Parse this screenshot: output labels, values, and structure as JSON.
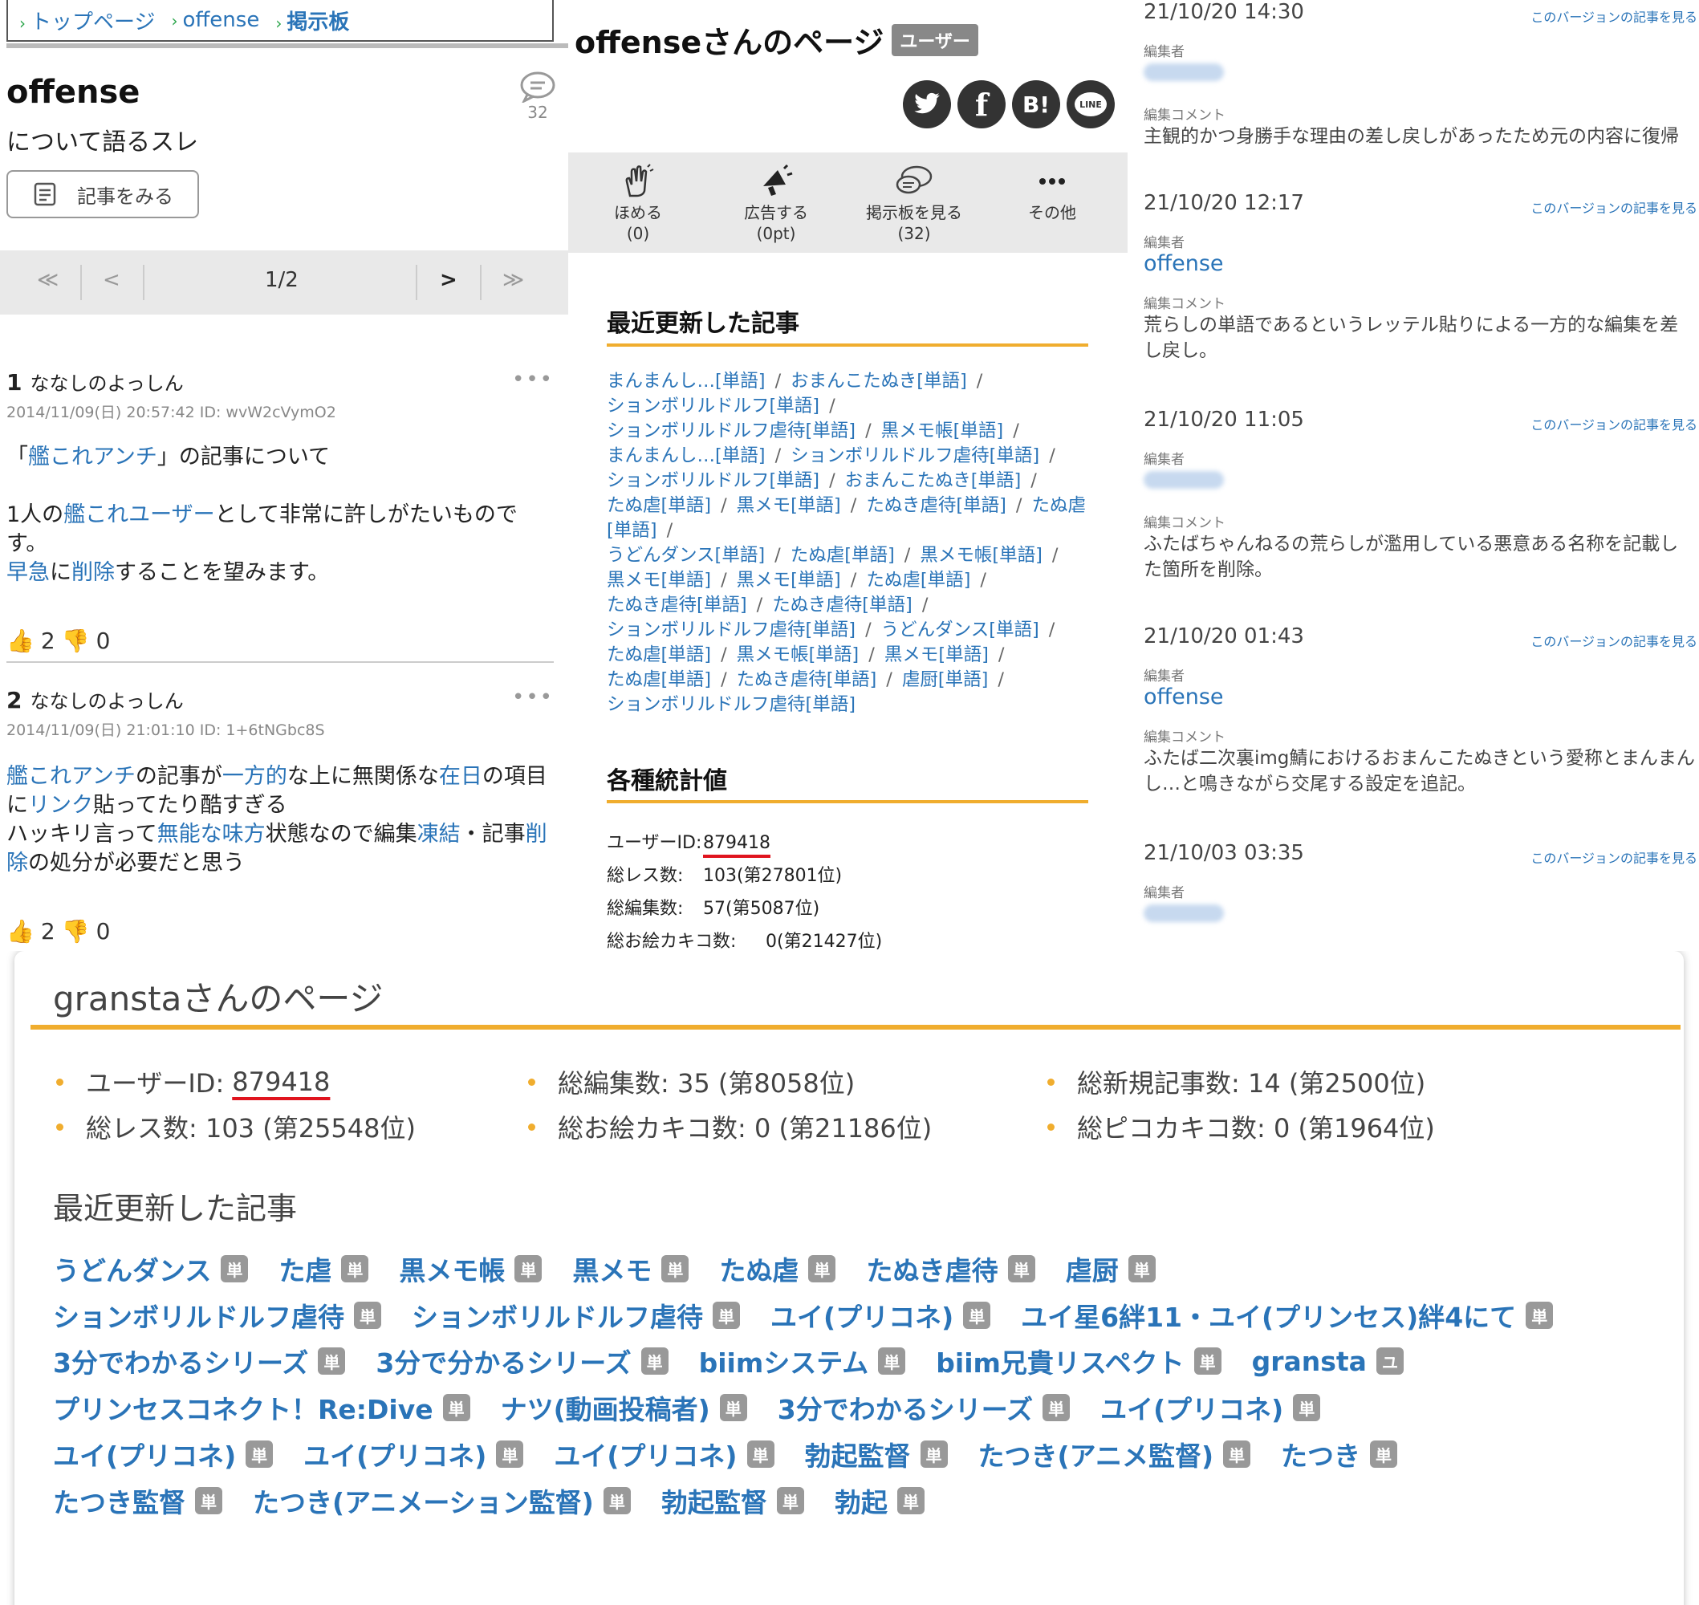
{
  "left": {
    "breadcrumb": [
      "トップページ",
      "offense",
      "掲示板"
    ],
    "title": "offense",
    "subtitle": "について語るスレ",
    "comment_count": "32",
    "view_button": "記事をみる",
    "pager": {
      "first": "≪",
      "prev": "<",
      "page": "1/2",
      "next": ">",
      "last": "≫"
    },
    "posts": [
      {
        "num": "1",
        "name": "ななしのよっしん",
        "meta": "2014/11/09(日) 20:57:42 ID: wvW2cVymO2",
        "l1a": "「",
        "l1b": "艦これアンチ",
        "l1c": "」の記事について",
        "l2a": "1人の",
        "l2b": "艦これユーザー",
        "l2c": "として非常に許しがたいもので",
        "l3": "す。",
        "l4a": "早急",
        "l4b": "に",
        "l4c": "削除",
        "l4d": "することを望みます。",
        "up": "2",
        "down": "0"
      },
      {
        "num": "2",
        "name": "ななしのよっしん",
        "meta": "2014/11/09(日) 21:01:10 ID: 1+6tNGbc8S",
        "l1a": "艦これアンチ",
        "l1b": "の記事が",
        "l1c": "一方的",
        "l1d": "な上に無関係な",
        "l1e": "在日",
        "l1f": "の項目",
        "l2a": "に",
        "l2b": "リンク",
        "l2c": "貼ってたり酷すぎる",
        "l3a": "ハッキリ言って",
        "l3b": "無能な味方",
        "l3c": "状態なので編集",
        "l3d": "凍結",
        "l3e": "・記事",
        "l3f": "削",
        "l4a": "除",
        "l4b": "の処分が必要だと思う",
        "up": "2",
        "down": "0"
      }
    ]
  },
  "mid": {
    "title": "offenseさんのページ",
    "badge": "ユーザー",
    "share": [
      "twitter-icon",
      "facebook-icon",
      "B!",
      "LINE"
    ],
    "tools": [
      {
        "label": "ほめる",
        "sub": "(0)"
      },
      {
        "label": "広告する",
        "sub": "(0pt)"
      },
      {
        "label": "掲示板を見る",
        "sub": "(32)"
      },
      {
        "label": "その他",
        "sub": ""
      }
    ],
    "recent_title": "最近更新した記事",
    "recent": [
      "まんまんし…[単語]",
      "おまんこたぬき[単語]",
      "ションボリルドルフ[単語]",
      "ションボリルドルフ虐待[単語]",
      "黒メモ帳[単語]",
      "まんまんし…[単語]",
      "ションボリルドルフ虐待[単語]",
      "ションボリルドルフ[単語]",
      "おまんこたぬき[単語]",
      "たぬ虐[単語]",
      "黒メモ[単語]",
      "たぬき虐待[単語]",
      "たぬ虐[単語]",
      "うどんダンス[単語]",
      "たぬ虐[単語]",
      "黒メモ帳[単語]",
      "黒メモ[単語]",
      "黒メモ[単語]",
      "たぬ虐[単語]",
      "たぬき虐待[単語]",
      "たぬき虐待[単語]",
      "ションボリルドルフ虐待[単語]",
      "うどんダンス[単語]",
      "たぬ虐[単語]",
      "黒メモ帳[単語]",
      "黒メモ[単語]",
      "たぬ虐[単語]",
      "たぬき虐待[単語]",
      "虐厨[単語]",
      "ションボリルドルフ虐待[単語]"
    ],
    "stats_title": "各種統計値",
    "stats": [
      {
        "label": "ユーザーID:",
        "value": "879418"
      },
      {
        "label": "総レス数:",
        "value": "103(第27801位)"
      },
      {
        "label": "総編集数:",
        "value": "57(第5087位)"
      },
      {
        "label": "総お絵カキコ数:",
        "value": "0(第21427位)"
      }
    ]
  },
  "right": {
    "link_text": "このバージョンの記事を見る",
    "editor_label": "編集者",
    "comment_label": "編集コメント",
    "revisions": [
      {
        "date": "21/10/20 14:30",
        "user": "",
        "comment": "主観的かつ身勝手な理由の差し戻しがあったため元の内容に復帰"
      },
      {
        "date": "21/10/20 12:17",
        "user": "offense",
        "comment": "荒らしの単語であるというレッテル貼りによる一方的な編集を差",
        "comment2": "し戻し。"
      },
      {
        "date": "21/10/20 11:05",
        "user": "",
        "comment": "ふたばちゃんねるの荒らしが濫用している悪意ある名称を記載し",
        "comment2": "た箇所を削除。"
      },
      {
        "date": "21/10/20 01:43",
        "user": "offense",
        "comment": "ふたば二次裏img鯖におけるおまんこたぬきという愛称とまんまん",
        "comment2": "し…と鳴きながら交尾する設定を追記。"
      },
      {
        "date": "21/10/03 03:35",
        "user": "",
        "comment": ""
      }
    ]
  },
  "bottom": {
    "title": "granstaさんのページ",
    "stats": [
      {
        "label": "ユーザーID: ",
        "value": "879418"
      },
      {
        "label": "総編集数: 35 (第8058位)",
        "value": ""
      },
      {
        "label": "総新規記事数: 14 (第2500位)",
        "value": ""
      },
      {
        "label": "総レス数: 103 (第25548位)",
        "value": ""
      },
      {
        "label": "総お絵カキコ数: 0 (第21186位)",
        "value": ""
      },
      {
        "label": "総ピコカキコ数: 0 (第1964位)",
        "value": ""
      }
    ],
    "recent_title": "最近更新した記事",
    "rows": [
      [
        [
          "うどんダンス",
          "単"
        ],
        [
          "た虐",
          "単"
        ],
        [
          "黒メモ帳",
          "単"
        ],
        [
          "黒メモ",
          "単"
        ],
        [
          "たぬ虐",
          "単"
        ],
        [
          "たぬき虐待",
          "単"
        ],
        [
          "虐厨",
          "単"
        ]
      ],
      [
        [
          "ションボリルドルフ虐待",
          "単"
        ],
        [
          "ションボリルドルフ虐待",
          "単"
        ],
        [
          "ユイ(プリコネ)",
          "単"
        ],
        [
          "ユイ星6絆11・ユイ(プリンセス)絆4にて",
          "単"
        ]
      ],
      [
        [
          "3分でわかるシリーズ",
          "単"
        ],
        [
          "3分で分かるシリーズ",
          "単"
        ],
        [
          "biimシステム",
          "単"
        ],
        [
          "biim兄貴リスペクト",
          "単"
        ],
        [
          "gransta",
          "ユ"
        ]
      ],
      [
        [
          "プリンセスコネクト！Re:Dive",
          "単"
        ],
        [
          "ナツ(動画投稿者)",
          "単"
        ],
        [
          "3分でわかるシリーズ",
          "単"
        ],
        [
          "ユイ(プリコネ)",
          "単"
        ]
      ],
      [
        [
          "ユイ(プリコネ)",
          "単"
        ],
        [
          "ユイ(プリコネ)",
          "単"
        ],
        [
          "ユイ(プリコネ)",
          "単"
        ],
        [
          "勃起監督",
          "単"
        ],
        [
          "たつき(アニメ監督)",
          "単"
        ],
        [
          "たつき",
          "単"
        ]
      ],
      [
        [
          "たつき監督",
          "単"
        ],
        [
          "たつき(アニメーション監督)",
          "単"
        ],
        [
          "勃起監督",
          "単"
        ],
        [
          "勃起",
          "単"
        ]
      ]
    ]
  }
}
